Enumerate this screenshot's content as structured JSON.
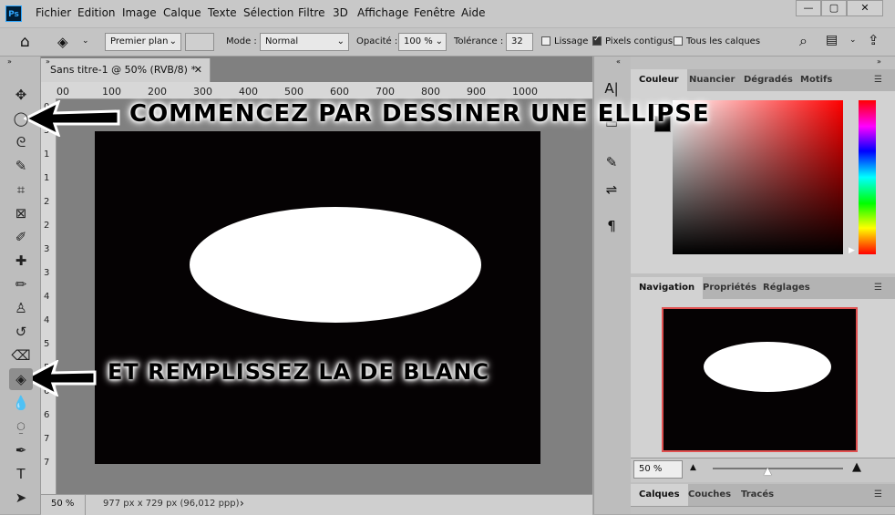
{
  "app": {
    "logo_text": "Ps"
  },
  "menu": [
    "Fichier",
    "Edition",
    "Image",
    "Calque",
    "Texte",
    "Sélection",
    "Filtre",
    "3D",
    "Affichage",
    "Fenêtre",
    "Aide"
  ],
  "window_controls": {
    "minimize": "—",
    "maximize": "▢",
    "close": "✕"
  },
  "options": {
    "fill_source": "Premier plan",
    "mode_label": "Mode :",
    "mode_value": "Normal",
    "opacity_label": "Opacité :",
    "opacity_value": "100 %",
    "tolerance_label": "Tolérance :",
    "tolerance_value": "32",
    "lissage": "Lissage",
    "lissage_checked": false,
    "pixels_contigus": "Pixels contigus",
    "pixels_contigus_checked": true,
    "tous_calques": "Tous les calques",
    "tous_calques_checked": false
  },
  "document": {
    "tab_title": "Sans titre-1 @ 50% (RVB/8) *",
    "close": "✕",
    "ruler_top": [
      "00",
      "100",
      "200",
      "300",
      "400",
      "500",
      "600",
      "700",
      "800",
      "900",
      "1000"
    ],
    "ruler_left": [
      "0",
      "5",
      "1",
      "1",
      "2",
      "2",
      "3",
      "3",
      "4",
      "4",
      "5",
      "5",
      "6",
      "6",
      "7",
      "7"
    ]
  },
  "status": {
    "zoom": "50 %",
    "info": "977 px x 729 px (96,012 ppp)",
    "arrow": "›"
  },
  "tools": [
    {
      "name": "move-tool",
      "glyph": "✥"
    },
    {
      "name": "ellipse-marquee-tool",
      "glyph": "◯"
    },
    {
      "name": "lasso-tool",
      "glyph": "ᘓ"
    },
    {
      "name": "quick-selection-tool",
      "glyph": "✎"
    },
    {
      "name": "crop-tool",
      "glyph": "⌗"
    },
    {
      "name": "frame-tool",
      "glyph": "⊠"
    },
    {
      "name": "eyedropper-tool",
      "glyph": "✐"
    },
    {
      "name": "healing-tool",
      "glyph": "✚"
    },
    {
      "name": "brush-tool",
      "glyph": "✏"
    },
    {
      "name": "stamp-tool",
      "glyph": "♙"
    },
    {
      "name": "history-brush-tool",
      "glyph": "↺"
    },
    {
      "name": "eraser-tool",
      "glyph": "⌫"
    },
    {
      "name": "paint-bucket-tool",
      "glyph": "◈"
    },
    {
      "name": "blur-tool",
      "glyph": "💧"
    },
    {
      "name": "dodge-tool",
      "glyph": "⍜"
    },
    {
      "name": "pen-tool",
      "glyph": "✒"
    },
    {
      "name": "type-tool",
      "glyph": "T"
    },
    {
      "name": "path-selection-tool",
      "glyph": "➤"
    }
  ],
  "side_icons": [
    "A|",
    "▭",
    "✎",
    "⇌",
    "¶"
  ],
  "panels": {
    "color_tabs": [
      "Couleur",
      "Nuancier",
      "Dégradés",
      "Motifs"
    ],
    "nav_tabs": [
      "Navigation",
      "Propriétés",
      "Réglages"
    ],
    "nav_zoom": "50 %",
    "layer_tabs": [
      "Calques",
      "Couches",
      "Tracés"
    ],
    "menu_icon": "☰"
  },
  "annotations": {
    "ellipse": "COMMENCEZ PAR DESSINER UNE ELLIPSE",
    "fill": "ET REMPLISSEZ LA DE BLANC"
  }
}
